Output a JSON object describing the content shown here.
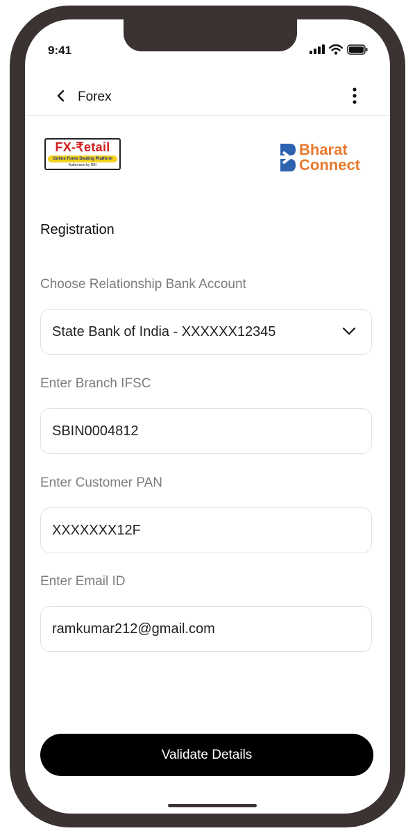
{
  "status_bar": {
    "time": "9:41",
    "icons": [
      "signal-icon",
      "wifi-icon",
      "battery-icon"
    ]
  },
  "header": {
    "back_icon": "chevron-left-icon",
    "title": "Forex",
    "menu_icon": "more-vertical-icon"
  },
  "logos": {
    "fx_retail": {
      "title": "FX-₹etail",
      "tagline": "Online Forex Dealing Platform",
      "authorized": "Authorised by RBI"
    },
    "bharat_connect": {
      "line1": "Bharat",
      "line2": "Connect"
    }
  },
  "form": {
    "title": "Registration",
    "bank_account": {
      "label": "Choose Relationship Bank Account",
      "value": "State Bank of India - XXXXXX12345"
    },
    "ifsc": {
      "label": "Enter Branch IFSC",
      "value": "SBIN0004812"
    },
    "pan": {
      "label": "Enter Customer PAN",
      "value": "XXXXXXX12F"
    },
    "email": {
      "label": "Enter Email ID",
      "value": "ramkumar212@gmail.com"
    }
  },
  "actions": {
    "validate_label": "Validate Details"
  },
  "colors": {
    "device_frame": "#3a3332",
    "primary_button": "#000000",
    "brand_orange": "#e67a2e",
    "brand_blue": "#2d62b0",
    "fx_red": "#d21f1f",
    "fx_yellow": "#f3d21b"
  }
}
